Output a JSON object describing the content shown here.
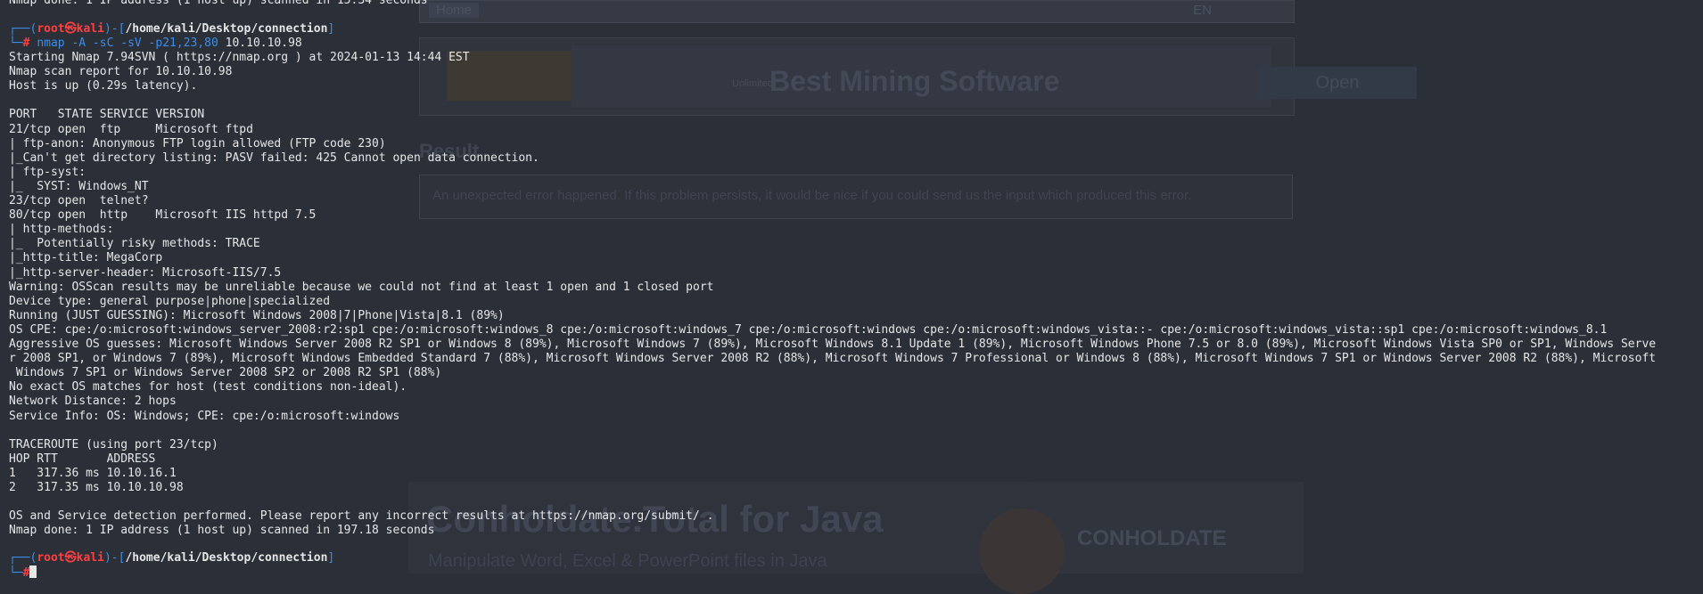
{
  "background_page": {
    "home_tab": "Home",
    "lang": "EN",
    "ad1_small": "Unlimited",
    "ad1_title": "Best Mining Software",
    "ad1_button": "Open",
    "result_heading": "Result",
    "error_message": "An unexpected error happened. If this problem persists, it would be nice if you could send us the input which produced this error.",
    "ad2_title": "Conholdate.Total for Java",
    "ad2_subtitle": "Manipulate Word, Excel & PowerPoint files in Java",
    "ad2_brand": "CONHOLDATE"
  },
  "terminal": {
    "top_partial": "Nmap done: 1 IP address (1 host up) scanned in 15.34 seconds",
    "prompt1": {
      "user": "root",
      "at": "㉿",
      "host": "kali",
      "path": "/home/kali/Desktop/connection",
      "cmd": "nmap",
      "args1": " -A -sC -sV -p21,23,80 ",
      "args2": "10.10.10.98"
    },
    "output": [
      "Starting Nmap 7.94SVN ( https://nmap.org ) at 2024-01-13 14:44 EST",
      "Nmap scan report for 10.10.10.98",
      "Host is up (0.29s latency).",
      "",
      "PORT   STATE SERVICE VERSION",
      "21/tcp open  ftp     Microsoft ftpd",
      "| ftp-anon: Anonymous FTP login allowed (FTP code 230)",
      "|_Can't get directory listing: PASV failed: 425 Cannot open data connection.",
      "| ftp-syst:",
      "|_  SYST: Windows_NT",
      "23/tcp open  telnet?",
      "80/tcp open  http    Microsoft IIS httpd 7.5",
      "| http-methods:",
      "|_  Potentially risky methods: TRACE",
      "|_http-title: MegaCorp",
      "|_http-server-header: Microsoft-IIS/7.5",
      "Warning: OSScan results may be unreliable because we could not find at least 1 open and 1 closed port",
      "Device type: general purpose|phone|specialized",
      "Running (JUST GUESSING): Microsoft Windows 2008|7|Phone|Vista|8.1 (89%)",
      "OS CPE: cpe:/o:microsoft:windows_server_2008:r2:sp1 cpe:/o:microsoft:windows_8 cpe:/o:microsoft:windows_7 cpe:/o:microsoft:windows cpe:/o:microsoft:windows_vista::- cpe:/o:microsoft:windows_vista::sp1 cpe:/o:microsoft:windows_8.1",
      "Aggressive OS guesses: Microsoft Windows Server 2008 R2 SP1 or Windows 8 (89%), Microsoft Windows 7 (89%), Microsoft Windows 8.1 Update 1 (89%), Microsoft Windows Phone 7.5 or 8.0 (89%), Microsoft Windows Vista SP0 or SP1, Windows Serve",
      "r 2008 SP1, or Windows 7 (89%), Microsoft Windows Embedded Standard 7 (88%), Microsoft Windows Server 2008 R2 (88%), Microsoft Windows 7 Professional or Windows 8 (88%), Microsoft Windows 7 SP1 or Windows Server 2008 R2 (88%), Microsoft",
      " Windows 7 SP1 or Windows Server 2008 SP2 or 2008 R2 SP1 (88%)",
      "No exact OS matches for host (test conditions non-ideal).",
      "Network Distance: 2 hops",
      "Service Info: OS: Windows; CPE: cpe:/o:microsoft:windows",
      "",
      "TRACEROUTE (using port 23/tcp)",
      "HOP RTT       ADDRESS",
      "1   317.36 ms 10.10.16.1",
      "2   317.35 ms 10.10.10.98",
      "",
      "OS and Service detection performed. Please report any incorrect results at https://nmap.org/submit/ .",
      "Nmap done: 1 IP address (1 host up) scanned in 197.18 seconds"
    ],
    "prompt2": {
      "user": "root",
      "at": "㉿",
      "host": "kali",
      "path": "/home/kali/Desktop/connection"
    },
    "prompt_glyph": "#"
  }
}
